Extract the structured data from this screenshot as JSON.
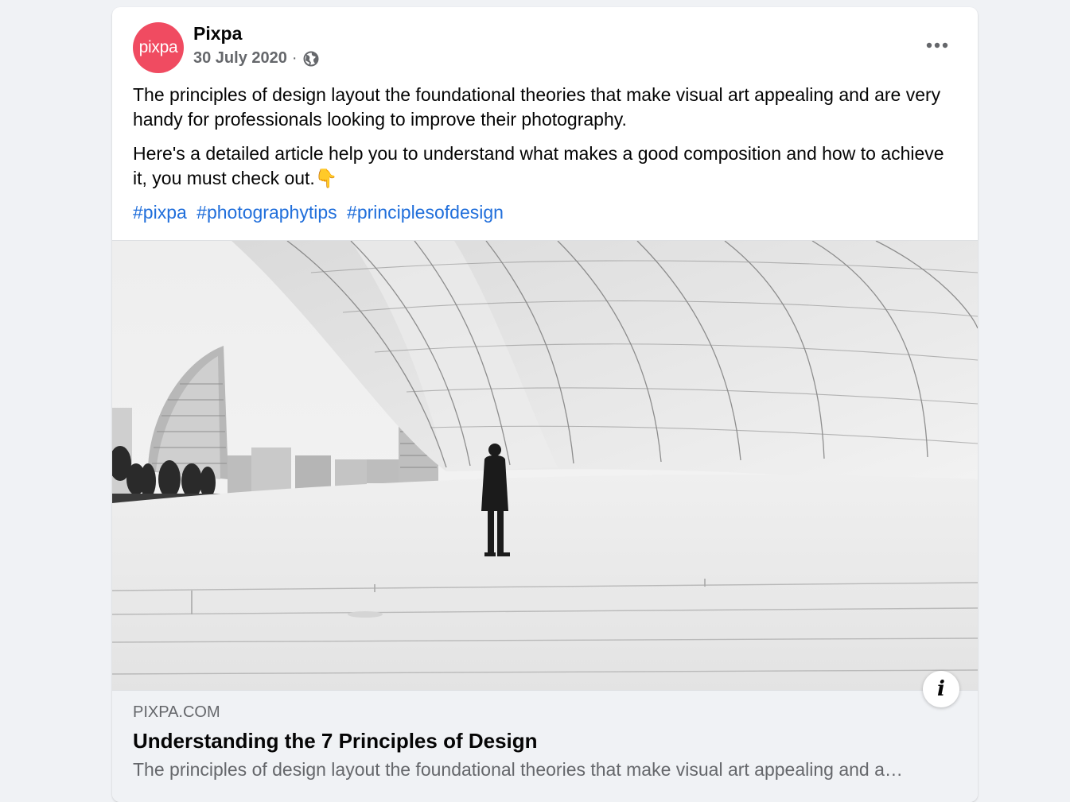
{
  "post": {
    "avatar_text": "pixpa",
    "author": "Pixpa",
    "date": "30 July 2020",
    "separator": "·",
    "privacy_icon": "globe-icon",
    "more_icon": "more-options-icon",
    "paragraphs": [
      "The principles of design layout the foundational theories that make visual art appealing and are very handy for professionals looking to improve their photography.",
      "Here's a detailed article help you to understand what makes a good composition and how to achieve it, you must check out.👇"
    ],
    "hashtags": [
      "#pixpa",
      "#photographytips",
      "#principlesofdesign"
    ]
  },
  "link_preview": {
    "image_description_icon": "architecture-photo",
    "info_label": "i",
    "domain": "PIXPA.COM",
    "title": "Understanding the 7 Principles of Design",
    "description": "The principles of design layout the foundational theories that make visual art appealing and a…"
  },
  "colors": {
    "brand_avatar": "#f04b61",
    "hashtag": "#216fdb",
    "secondary_text": "#65676b",
    "background": "#f0f2f5"
  }
}
